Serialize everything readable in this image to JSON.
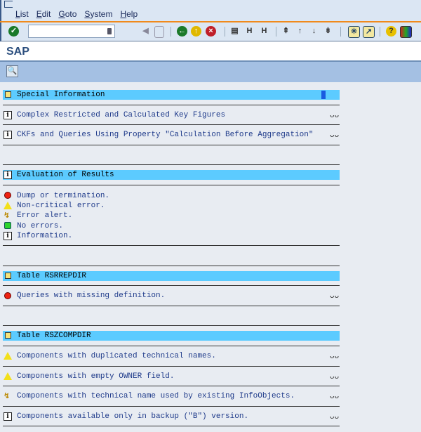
{
  "menu": [
    "List",
    "Edit",
    "Goto",
    "System",
    "Help"
  ],
  "title": "SAP",
  "sections": [
    {
      "header": "Special Information",
      "rows": [
        "Complex Restricted and Calculated Key Figures",
        "CKFs and Queries Using Property \"Calculation Before Aggregation\""
      ]
    },
    {
      "header": "Evaluation of Results",
      "legend": [
        "Dump or termination.",
        "Non-critical error.",
        "Error alert.",
        "No errors.",
        "Information."
      ]
    },
    {
      "header": "Table RSRREPDIR",
      "rows": [
        "Queries with missing definition."
      ]
    },
    {
      "header": "Table RSZCOMPDIR",
      "rows": [
        "Components with duplicated technical names.",
        "Components with empty OWNER field.",
        "Components with technical name used by existing InfoObjects.",
        "Components available only in backup (\"B\") version."
      ]
    }
  ],
  "colors": {
    "header_bar": "#5ccbff",
    "accent": "#f08a1c"
  }
}
